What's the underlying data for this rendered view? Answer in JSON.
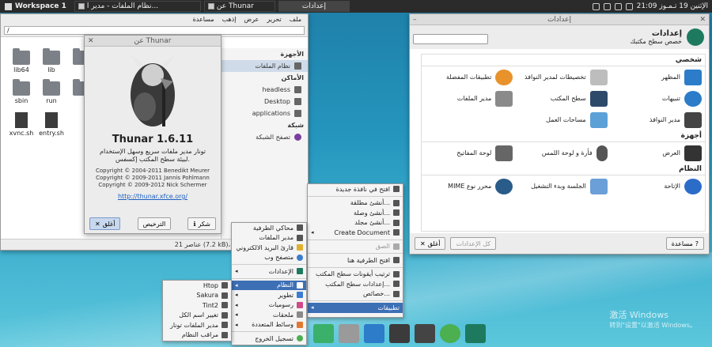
{
  "panel": {
    "workspace": "Workspace 1",
    "tasks": [
      "نظام الملفات - مدير ا...",
      "عن Thunar",
      "إعدادات"
    ],
    "clock": "21:09 الإثنين 19 تـمـوز"
  },
  "filemanager": {
    "menu": [
      "ملف",
      "تحرير",
      "عرض",
      "إذهب",
      "مساعدة"
    ],
    "path": "/",
    "sidebar_headers": [
      "الأجهزة",
      "الأماكن",
      "شبكة"
    ],
    "sidebar_items": [
      "نظام الملفات",
      "headless",
      "Desktop",
      "applications",
      "تصفح الشبكة"
    ],
    "files": [
      "lib64",
      "lib",
      "",
      "sbin",
      "run",
      "",
      "xvnc.sh",
      "entry.sh"
    ],
    "status": "21 عناصر (7.2 kB)، المساحة الحالية: 15.2 GB"
  },
  "about": {
    "title": "عن Thunar",
    "name": "Thunar 1.6.11",
    "desc1": "تونار مدير ملفات سريع وسهل الإستخدام",
    "desc2": "لبيئة سطح المكتب إكسفس.",
    "copy1": "Copyright © 2004-2011 Benedikt Meurer",
    "copy2": "Copyright © 2009-2011 Jannis Pohlmann",
    "copy3": "Copyright © 2009-2012 Nick Schermer",
    "url": "http://thunar.xfce.org/",
    "btn_close": "أغلق",
    "btn_license": "الترخيص",
    "btn_credits": "شكر"
  },
  "settings": {
    "title": "إعدادات",
    "heading": "إعدادات",
    "subheading": "خصص سطح مكتبك",
    "categories": [
      {
        "name": "شخصي",
        "items": [
          "المظهر",
          "تخصيطات لمدير النوافذ",
          "تطبيقات المفضلة",
          "تنبيهات",
          "سطح المكتب",
          "مدير الملفات",
          "مدير النوافذ",
          "مساحات العمل",
          ""
        ]
      },
      {
        "name": "أجهزة",
        "items": [
          "العرض",
          "فأرة و لوحة اللمس",
          "لوحة المفاتيح"
        ]
      },
      {
        "name": "النظام",
        "items": [
          "الإتاحة",
          "الجلسة وبدء التشغيل",
          "محرر نوع MIME"
        ]
      }
    ],
    "help": "مساعدة",
    "all": "كل الإعدادات",
    "close": "أغلق"
  },
  "desktop_menu": {
    "items": [
      "افتح في نافذة جديدة",
      "أنشئ مطلقة...",
      "أنشئ وصلة...",
      "أنشئ مجلد...",
      "Create Document",
      "الصق",
      "افتح الطرفية هنا",
      "ترتيب أيقونات سطح المكتب",
      "إعدادات سطح المكتب...",
      "خصائص...",
      "تطبيقات"
    ]
  },
  "apps_menu": {
    "items": [
      "محاكي الطرفية",
      "مدير الملفات",
      "قارئ البريد الالكتروني",
      "متصفح وب",
      "الإعدادات",
      "النظام",
      "تطوير",
      "رسوميات",
      "ملحقات",
      "وسائط المتعددة",
      "تسجيل الخروج"
    ]
  },
  "system_menu": {
    "items": [
      "Htop",
      "Sakura",
      "Tint2",
      "تغيير اسم الكل",
      "مدير الملفات تونار",
      "مراقب النظام"
    ]
  },
  "watermark": {
    "line1": "激活 Windows",
    "line2": "转到\"设置\"以激活 Windows。"
  }
}
